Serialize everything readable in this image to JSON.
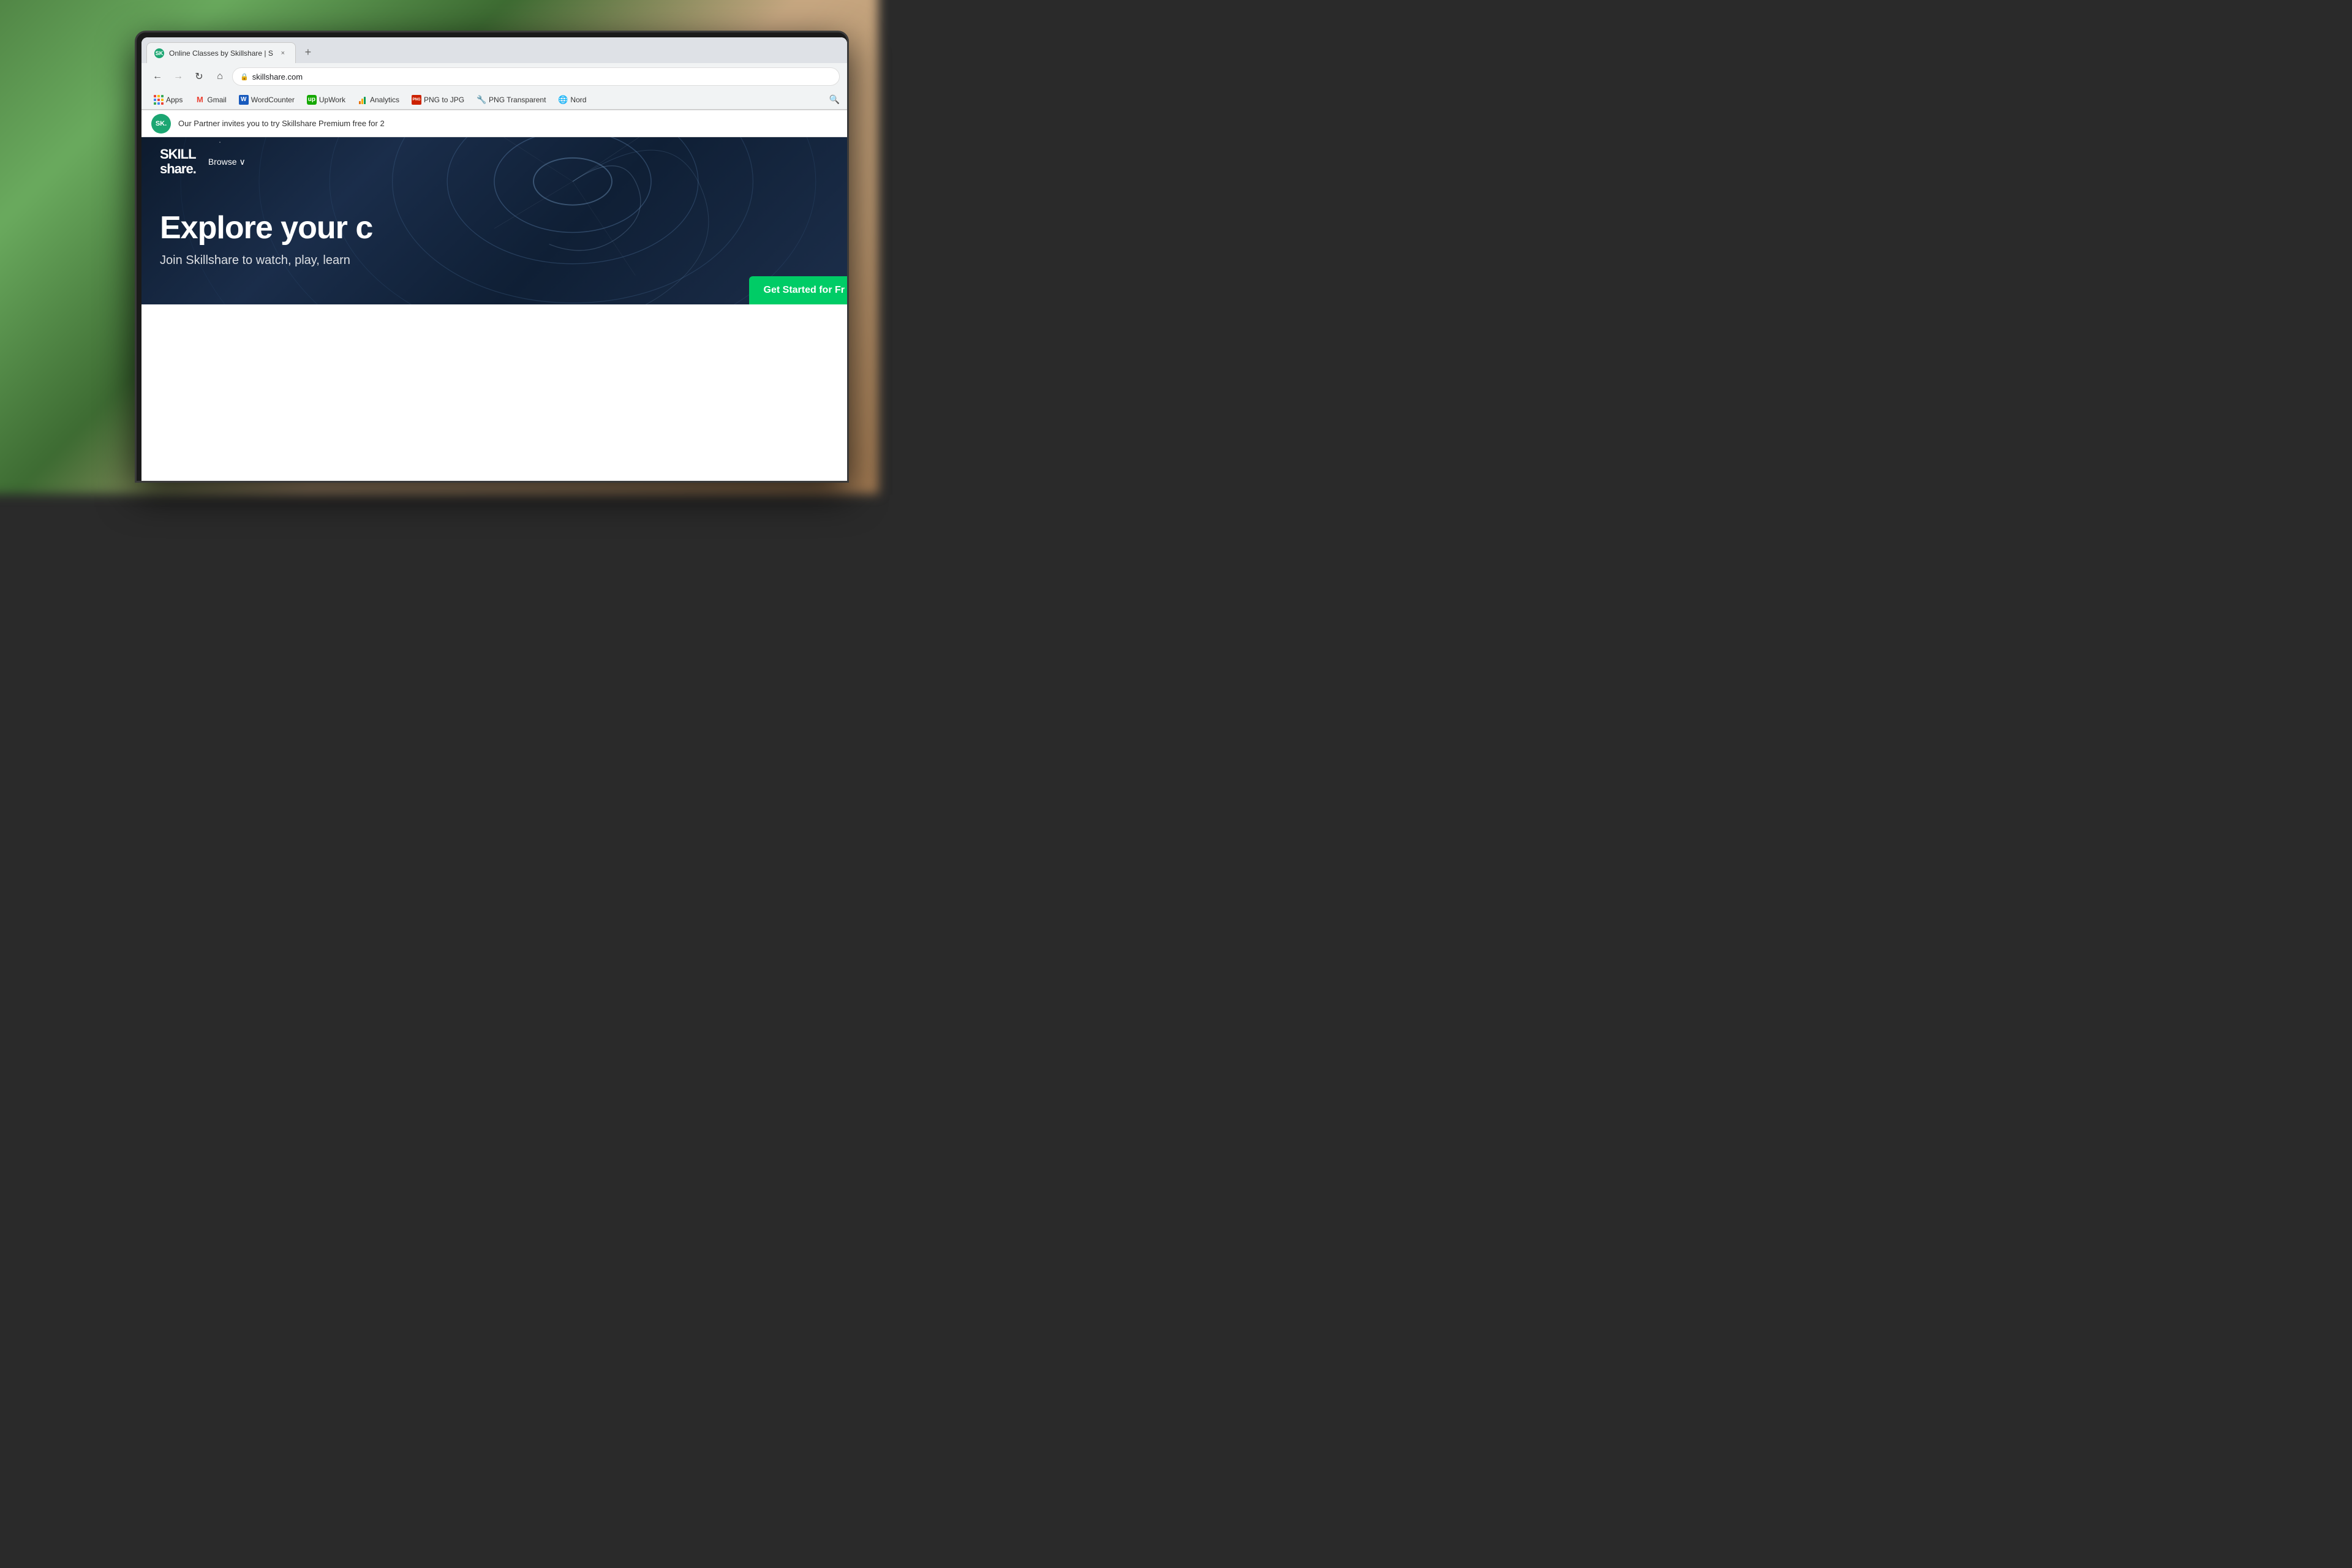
{
  "browser": {
    "tab": {
      "favicon_label": "SK",
      "title": "Online Classes by Skillshare | S",
      "close_label": "×",
      "new_tab_label": "+"
    },
    "nav": {
      "back_icon": "←",
      "forward_icon": "→",
      "refresh_icon": "↻",
      "home_icon": "⌂",
      "lock_icon": "🔒",
      "url": "skillshare.com"
    },
    "bookmarks": [
      {
        "id": "apps",
        "label": "Apps",
        "type": "apps"
      },
      {
        "id": "gmail",
        "label": "Gmail",
        "type": "gmail"
      },
      {
        "id": "wordcounter",
        "label": "WordCounter",
        "type": "word"
      },
      {
        "id": "upwork",
        "label": "UpWork",
        "type": "upwork"
      },
      {
        "id": "analytics",
        "label": "Analytics",
        "type": "analytics"
      },
      {
        "id": "png-to-jpg",
        "label": "PNG to JPG",
        "type": "png-jpg"
      },
      {
        "id": "png-transparent",
        "label": "PNG Transparent",
        "type": "png-transparent"
      },
      {
        "id": "nord",
        "label": "Nord",
        "type": "nord"
      }
    ],
    "notification": {
      "badge_label": "SK.",
      "text": "Our Partner invites you to try Skillshare Premium free for 2"
    }
  },
  "skillshare": {
    "logo_line1": "SKILL",
    "logo_line2": "share.",
    "browse_label": "Browse",
    "browse_chevron": "∨",
    "hero_title": "Explore your c",
    "hero_subtitle": "Join Skillshare to watch, play, learn",
    "cta_label": "Get Started for Fr"
  }
}
